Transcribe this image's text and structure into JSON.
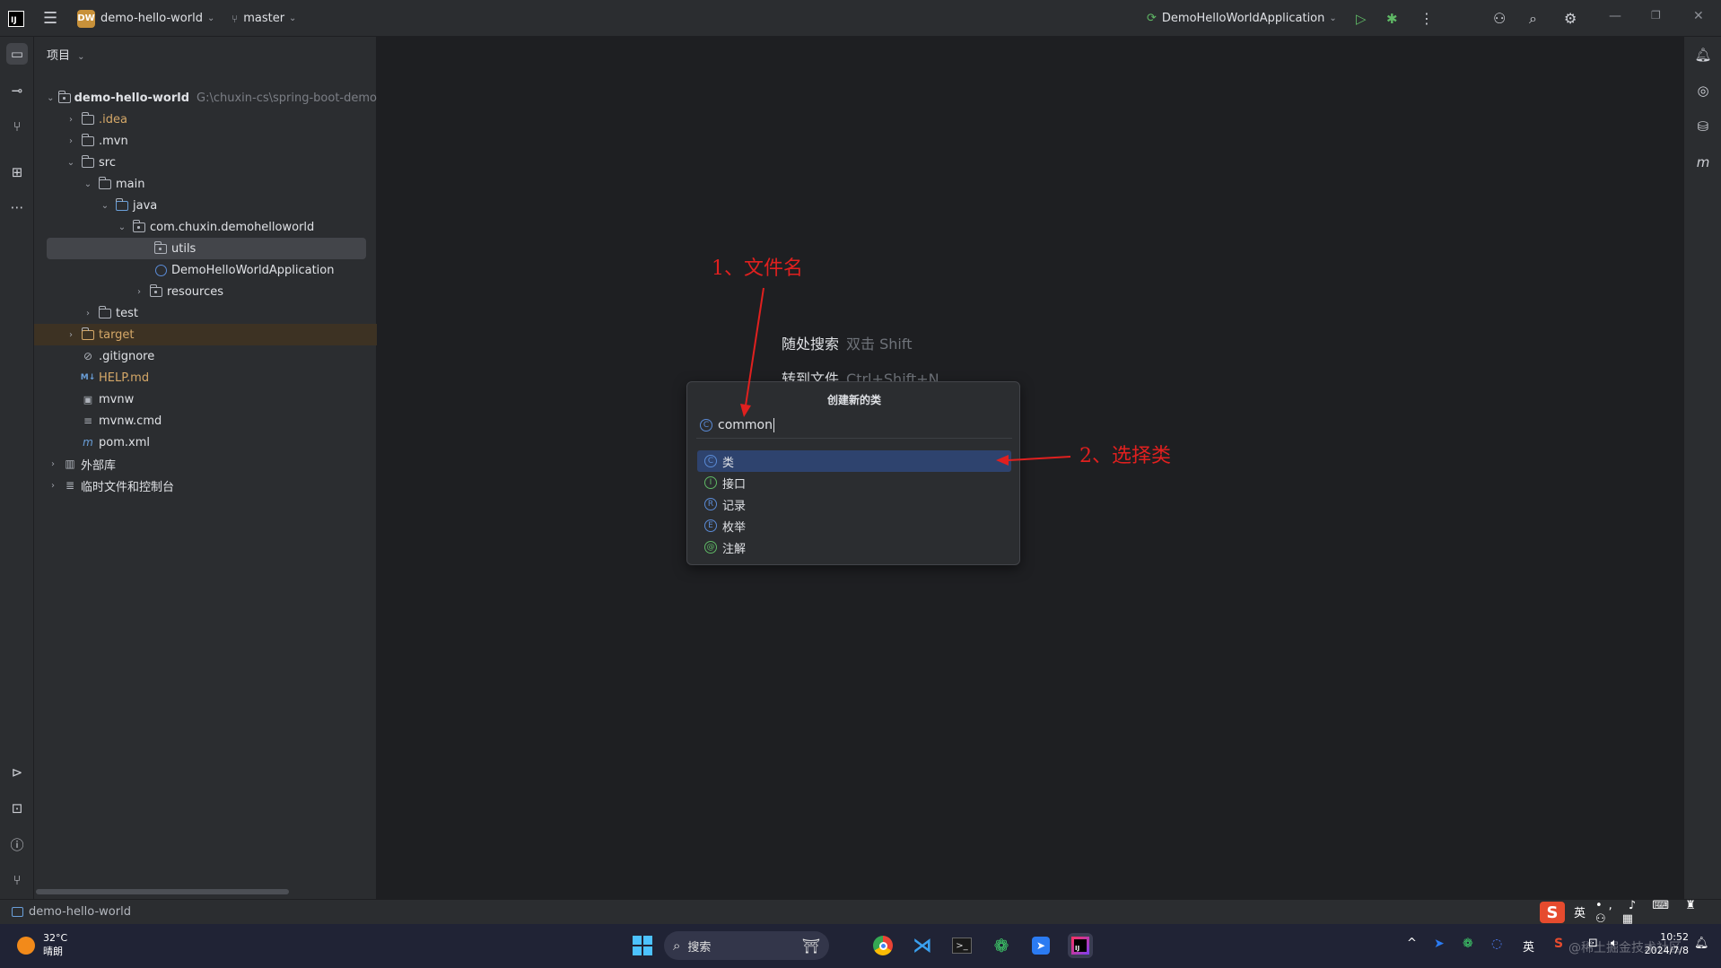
{
  "titlebar": {
    "project_badge": "DW",
    "project_name": "demo-hello-world",
    "branch": "master",
    "run_config": "DemoHelloWorldApplication"
  },
  "panel": {
    "title": "项目",
    "tree": [
      {
        "label": "demo-hello-world",
        "suffix": "G:\\chuxin-cs\\spring-boot-demo"
      },
      {
        "label": ".idea"
      },
      {
        "label": ".mvn"
      },
      {
        "label": "src"
      },
      {
        "label": "main"
      },
      {
        "label": "java"
      },
      {
        "label": "com.chuxin.demohelloworld"
      },
      {
        "label": "utils"
      },
      {
        "label": "DemoHelloWorldApplication"
      },
      {
        "label": "resources"
      },
      {
        "label": "test"
      },
      {
        "label": "target"
      },
      {
        "label": ".gitignore"
      },
      {
        "label": "HELP.md"
      },
      {
        "label": "mvnw"
      },
      {
        "label": "mvnw.cmd"
      },
      {
        "label": "pom.xml"
      },
      {
        "label": "外部库"
      },
      {
        "label": "临时文件和控制台"
      }
    ]
  },
  "editor_hints": [
    {
      "label": "随处搜索",
      "shortcut": "双击 Shift"
    },
    {
      "label": "转到文件",
      "shortcut": "Ctrl+Shift+N"
    }
  ],
  "popup": {
    "title": "创建新的类",
    "input_value": "common",
    "options": [
      {
        "label": "类",
        "icon": "C"
      },
      {
        "label": "接口",
        "icon": "I"
      },
      {
        "label": "记录",
        "icon": "R"
      },
      {
        "label": "枚举",
        "icon": "E"
      },
      {
        "label": "注解",
        "icon": "@"
      }
    ]
  },
  "annotations": {
    "step1": "1、文件名",
    "step2": "2、选择类"
  },
  "statusbar": {
    "path": "demo-hello-world"
  },
  "taskbar": {
    "temperature": "32°C",
    "weather": "晴朗",
    "search_label": "搜索",
    "ime_lang": "英",
    "ime_lang_tray": "英",
    "time": "10:52",
    "date": "2024/7/8",
    "watermark": "@稀土掘金技术社区"
  },
  "colors": {
    "accent_selection": "#2e436e",
    "annotation_red": "#e0201f",
    "project_badge": "#c8913a",
    "ide_bg": "#1e1f22",
    "panel_bg": "#2b2d30"
  }
}
